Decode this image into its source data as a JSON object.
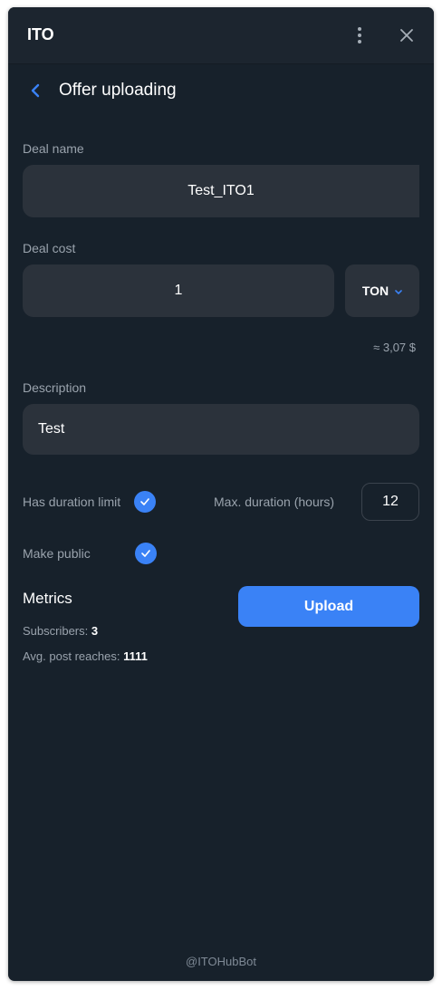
{
  "window": {
    "title": "ITO",
    "menu_icon": "more-vertical-icon",
    "close_icon": "close-icon"
  },
  "header": {
    "back_icon": "chevron-left-icon",
    "title": "Offer uploading"
  },
  "form": {
    "deal_name": {
      "label": "Deal name",
      "value": "Test_ITO1"
    },
    "deal_cost": {
      "label": "Deal cost",
      "value": "1",
      "currency": "TON",
      "approx": "≈ 3,07 $"
    },
    "description": {
      "label": "Description",
      "value": "Test"
    },
    "duration_limit": {
      "label": "Has duration limit",
      "checked": true
    },
    "max_duration": {
      "label": "Max. duration (hours)",
      "value": "12"
    },
    "make_public": {
      "label": "Make public",
      "checked": true
    }
  },
  "metrics": {
    "title": "Metrics",
    "subscribers_label": "Subscribers:",
    "subscribers_value": "3",
    "reach_label": "Avg. post reaches:",
    "reach_value": "1111"
  },
  "actions": {
    "upload_label": "Upload"
  },
  "footer": {
    "bot_handle": "@ITOHubBot"
  },
  "colors": {
    "background": "#17212b",
    "field": "#2b323b",
    "accent": "#3a82f6",
    "muted_text": "#9aa3ad"
  }
}
